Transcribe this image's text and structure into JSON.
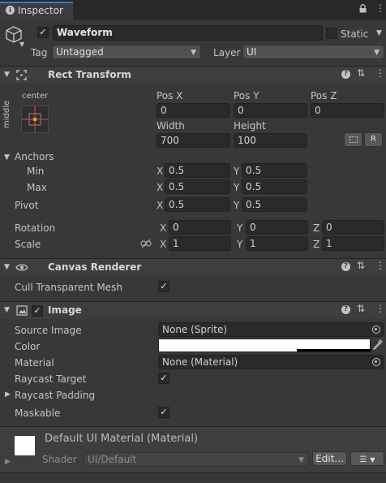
{
  "tab": {
    "label": "Inspector",
    "lock_icon": "lock-icon",
    "menu_icon": "kebab-menu-icon"
  },
  "object": {
    "active": true,
    "name": "Waveform",
    "static_label": "Static",
    "static_checked": false,
    "tag_label": "Tag",
    "tag_value": "Untagged",
    "layer_label": "Layer",
    "layer_value": "UI"
  },
  "rect_transform": {
    "title": "Rect Transform",
    "anchor_preset_h": "center",
    "anchor_preset_v": "middle",
    "pos_x_label": "Pos X",
    "pos_y_label": "Pos Y",
    "pos_z_label": "Pos Z",
    "pos_x": "0",
    "pos_y": "0",
    "pos_z": "0",
    "width_label": "Width",
    "height_label": "Height",
    "width": "700",
    "height": "100",
    "raw_button": "R",
    "anchors_label": "Anchors",
    "min_label": "Min",
    "max_label": "Max",
    "min_x": "0.5",
    "min_y": "0.5",
    "max_x": "0.5",
    "max_y": "0.5",
    "pivot_label": "Pivot",
    "pivot_x": "0.5",
    "pivot_y": "0.5",
    "rotation_label": "Rotation",
    "rot_x": "0",
    "rot_y": "0",
    "rot_z": "0",
    "scale_label": "Scale",
    "scale_x": "1",
    "scale_y": "1",
    "scale_z": "1",
    "axis_x": "X",
    "axis_y": "Y",
    "axis_z": "Z"
  },
  "canvas_renderer": {
    "title": "Canvas Renderer",
    "cull_label": "Cull Transparent Mesh",
    "cull_checked": true
  },
  "image": {
    "title": "Image",
    "enabled": true,
    "source_image_label": "Source Image",
    "source_image_value": "None (Sprite)",
    "color_label": "Color",
    "color_value": "#ffffff",
    "material_label": "Material",
    "material_value": "None (Material)",
    "raycast_target_label": "Raycast Target",
    "raycast_target_checked": true,
    "raycast_padding_label": "Raycast Padding",
    "maskable_label": "Maskable",
    "maskable_checked": true
  },
  "material_panel": {
    "title": "Default UI Material (Material)",
    "shader_label": "Shader",
    "shader_value": "UI/Default",
    "edit_button": "Edit..."
  },
  "colors": {
    "background": "#383838",
    "header": "#3e3e3e",
    "field": "#2a2a2a",
    "anchor_red": "#e04848",
    "anchor_orange": "#f0a020"
  }
}
